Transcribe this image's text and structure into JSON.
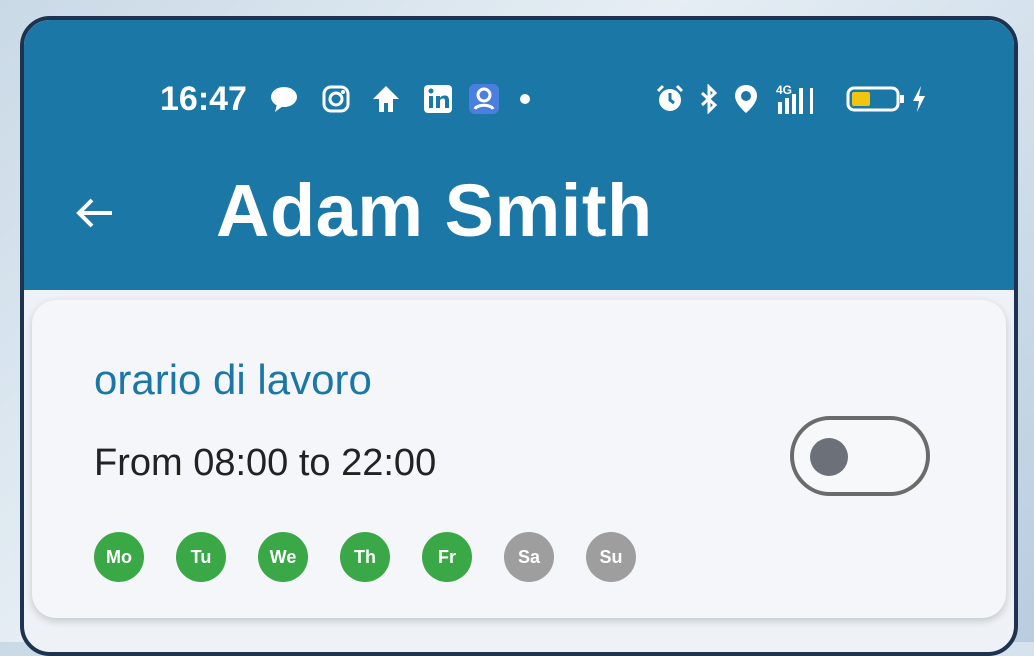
{
  "status_bar": {
    "time": "16:47",
    "network": "4G",
    "icons": [
      "chat-icon",
      "instagram-icon",
      "home-icon",
      "linkedin-icon",
      "account-icon",
      "dot-icon",
      "alarm-icon",
      "bluetooth-icon",
      "location-icon",
      "signal-icon",
      "battery-icon",
      "charging-icon"
    ],
    "battery_level": 0.35
  },
  "header": {
    "back_icon": "arrow-left-icon",
    "title": "Adam Smith",
    "background": "#1b77a5"
  },
  "schedule_card": {
    "title": "orario di lavoro",
    "range": "From 08:00 to 22:00",
    "enabled": false,
    "days": [
      {
        "label": "Mo",
        "active": true
      },
      {
        "label": "Tu",
        "active": true
      },
      {
        "label": "We",
        "active": true
      },
      {
        "label": "Th",
        "active": true
      },
      {
        "label": "Fr",
        "active": true
      },
      {
        "label": "Sa",
        "active": false
      },
      {
        "label": "Su",
        "active": false
      }
    ],
    "colors": {
      "active": "#3aa846",
      "inactive": "#9e9e9e",
      "title": "#1b77a5"
    }
  }
}
